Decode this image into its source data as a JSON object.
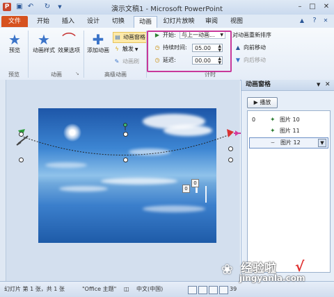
{
  "window": {
    "title": "演示文稿1 - Microsoft PowerPoint",
    "controls": [
      "–",
      "□",
      "✕"
    ]
  },
  "tabs": [
    {
      "label": "文件"
    },
    {
      "label": "开始"
    },
    {
      "label": "插入"
    },
    {
      "label": "设计"
    },
    {
      "label": "切换"
    },
    {
      "label": "动画"
    },
    {
      "label": "幻灯片放映"
    },
    {
      "label": "审阅"
    },
    {
      "label": "视图"
    }
  ],
  "active_tab": "动画",
  "ribbon": {
    "preview": {
      "button": "预览",
      "group": "预览"
    },
    "animation": {
      "style_button": "动画样式",
      "effect_button": "效果选项",
      "group": "动画"
    },
    "advanced": {
      "add_button": "添加动画",
      "pane_button": "动画窗格",
      "trigger_button": "触发",
      "painter_button": "动画刷",
      "group": "高级动画"
    },
    "timing": {
      "start_label": "开始:",
      "start_value": "与上一动画...",
      "duration_label": "持续时间:",
      "duration_value": "05.00",
      "delay_label": "延迟:",
      "delay_value": "00.00",
      "reorder_title": "对动画重新排序",
      "move_earlier": "向前移动",
      "move_later": "向后移动",
      "group": "计时"
    }
  },
  "slide": {
    "tag_a": "0",
    "tag_b": "0"
  },
  "animation_pane": {
    "title": "动画窗格",
    "play_button": "播放",
    "items": [
      {
        "num": "0",
        "label": "图片 10"
      },
      {
        "num": "",
        "label": "图片 11"
      },
      {
        "num": "",
        "label": "图片 12"
      }
    ]
  },
  "statusbar": {
    "slide_info": "幻灯片 第 1 张，共 1 张",
    "theme": "\"Office 主题\"",
    "language": "中文(中国)",
    "zoom": "39"
  },
  "watermark": {
    "text": "经验啦",
    "url": "jingyanla.com",
    "check": "√"
  },
  "colors": {
    "file_tab": "#d6521f",
    "highlight_box": "#c8389a",
    "accent": "#3a73c8"
  }
}
